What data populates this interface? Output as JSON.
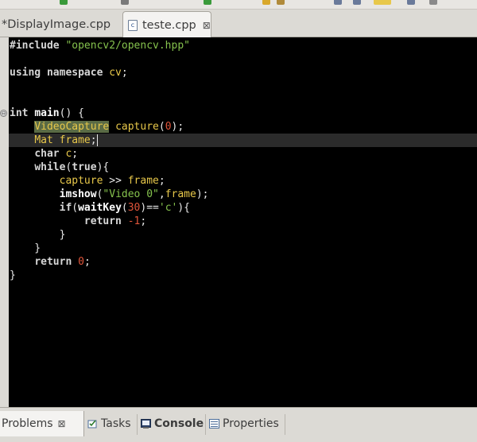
{
  "editor_tabs": [
    {
      "label": "*DisplayImage.cpp",
      "active": false
    },
    {
      "label": "teste.cpp",
      "active": true,
      "close_glyph": "⊠"
    }
  ],
  "code": {
    "lines": [
      [
        {
          "t": "pp",
          "s": "#include "
        },
        {
          "t": "str",
          "s": "\"opencv2/opencv.hpp\""
        }
      ],
      [],
      [
        {
          "t": "kw",
          "s": "using namespace "
        },
        {
          "t": "var",
          "s": "cv"
        },
        {
          "t": "plain",
          "s": ";"
        }
      ],
      [],
      [],
      [
        {
          "t": "kw",
          "s": "int "
        },
        {
          "t": "fn",
          "s": "main"
        },
        {
          "t": "plain",
          "s": "() {"
        }
      ],
      [
        {
          "t": "plain",
          "s": "    "
        },
        {
          "t": "hl",
          "s": "VideoCapture"
        },
        {
          "t": "plain",
          "s": " "
        },
        {
          "t": "var",
          "s": "capture"
        },
        {
          "t": "plain",
          "s": "("
        },
        {
          "t": "num",
          "s": "0"
        },
        {
          "t": "plain",
          "s": ");"
        }
      ],
      [
        {
          "t": "plain",
          "s": "    "
        },
        {
          "t": "type",
          "s": "Mat"
        },
        {
          "t": "plain",
          "s": " "
        },
        {
          "t": "var",
          "s": "frame"
        },
        {
          "t": "plain",
          "s": ";"
        }
      ],
      [
        {
          "t": "plain",
          "s": "    "
        },
        {
          "t": "kw",
          "s": "char "
        },
        {
          "t": "var",
          "s": "c"
        },
        {
          "t": "plain",
          "s": ";"
        }
      ],
      [
        {
          "t": "plain",
          "s": "    "
        },
        {
          "t": "kw",
          "s": "while"
        },
        {
          "t": "plain",
          "s": "("
        },
        {
          "t": "kw",
          "s": "true"
        },
        {
          "t": "plain",
          "s": "){"
        }
      ],
      [
        {
          "t": "plain",
          "s": "        "
        },
        {
          "t": "var",
          "s": "capture"
        },
        {
          "t": "plain",
          "s": " >> "
        },
        {
          "t": "var",
          "s": "frame"
        },
        {
          "t": "plain",
          "s": ";"
        }
      ],
      [
        {
          "t": "plain",
          "s": "        "
        },
        {
          "t": "fn",
          "s": "imshow"
        },
        {
          "t": "plain",
          "s": "("
        },
        {
          "t": "str",
          "s": "\"Video 0\""
        },
        {
          "t": "plain",
          "s": ","
        },
        {
          "t": "var",
          "s": "frame"
        },
        {
          "t": "plain",
          "s": ");"
        }
      ],
      [
        {
          "t": "plain",
          "s": "        "
        },
        {
          "t": "kw",
          "s": "if"
        },
        {
          "t": "plain",
          "s": "("
        },
        {
          "t": "fn",
          "s": "waitKey"
        },
        {
          "t": "plain",
          "s": "("
        },
        {
          "t": "num",
          "s": "30"
        },
        {
          "t": "plain",
          "s": ")=="
        },
        {
          "t": "str",
          "s": "'c'"
        },
        {
          "t": "plain",
          "s": "){"
        }
      ],
      [
        {
          "t": "plain",
          "s": "            "
        },
        {
          "t": "kw",
          "s": "return "
        },
        {
          "t": "num",
          "s": "-1"
        },
        {
          "t": "plain",
          "s": ";"
        }
      ],
      [
        {
          "t": "plain",
          "s": "        }"
        }
      ],
      [
        {
          "t": "plain",
          "s": "    }"
        }
      ],
      [
        {
          "t": "plain",
          "s": "    "
        },
        {
          "t": "kw",
          "s": "return "
        },
        {
          "t": "num",
          "s": "0"
        },
        {
          "t": "plain",
          "s": ";"
        }
      ],
      [
        {
          "t": "plain",
          "s": "}"
        }
      ]
    ],
    "current_line": 7,
    "fold_line": 5,
    "fold_glyph": "⊖"
  },
  "view_tabs": [
    {
      "name": "problems",
      "label": "Problems",
      "active": true,
      "close_glyph": "⊠"
    },
    {
      "name": "tasks",
      "label": "Tasks",
      "active": false
    },
    {
      "name": "console",
      "label": "Console",
      "active": false,
      "bold": true
    },
    {
      "name": "properties",
      "label": "Properties",
      "active": false
    }
  ],
  "colors": {
    "editor_bg": "#000000",
    "keyword": "#d7d7d7",
    "string": "#85c24d",
    "number": "#e0553a",
    "identifier": "#e8c84a",
    "highlight": "#5a6b45"
  }
}
